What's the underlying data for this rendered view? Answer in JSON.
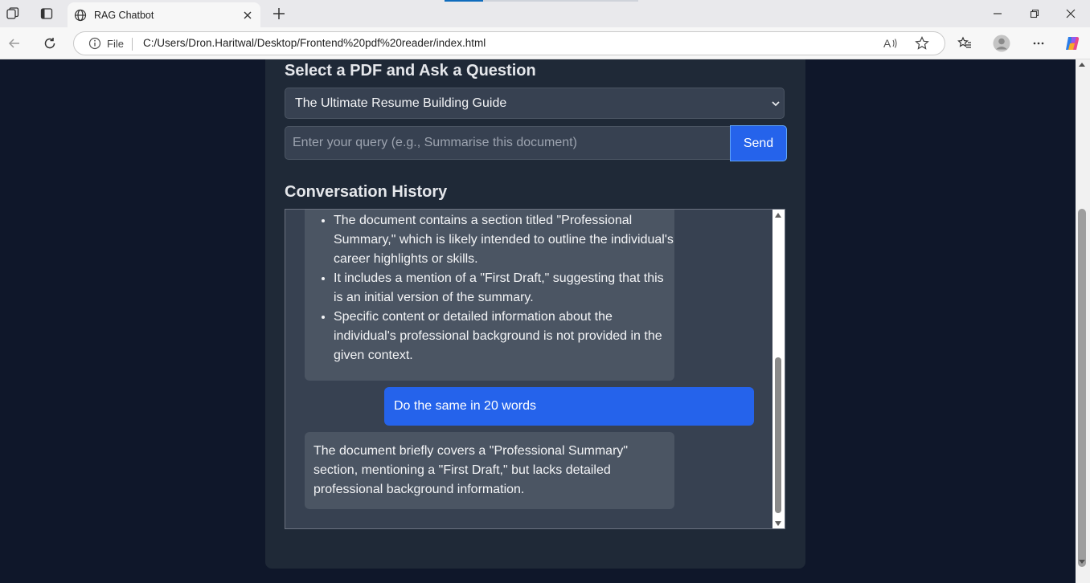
{
  "browser": {
    "tab_title": "RAG Chatbot",
    "address_label": "File",
    "url": "C:/Users/Dron.Haritwal/Desktop/Frontend%20pdf%20reader/index.html"
  },
  "page": {
    "select_heading": "Select a PDF and Ask a Question",
    "selected_pdf": "The Ultimate Resume Building Guide",
    "query_placeholder": "Enter your query (e.g., Summarise this document)",
    "send_label": "Send",
    "history_heading": "Conversation History"
  },
  "conversation": {
    "bot_bullets": [
      "The document contains a section titled \"Professional Summary,\" which is likely intended to outline the individual's career highlights or skills.",
      "It includes a mention of a \"First Draft,\" suggesting that this is an initial version of the summary.",
      "Specific content or detailed information about the individual's professional background is not provided in the given context."
    ],
    "user_message": "Do the same in 20 words",
    "bot_reply": "The document briefly covers a \"Professional Summary\" section, mentioning a \"First Draft,\" but lacks detailed professional background information."
  },
  "colors": {
    "page_bg": "#0f172a",
    "card_bg": "#1f2937",
    "input_bg": "#374151",
    "bot_bubble": "#4b5563",
    "accent": "#2563eb"
  }
}
